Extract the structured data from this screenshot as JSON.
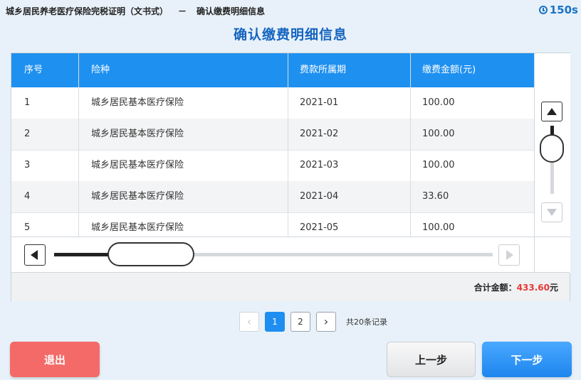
{
  "header": {
    "title": "城乡居民养老医疗保险完税证明（文书式）",
    "separator": "－",
    "step": "确认缴费明细信息",
    "countdown": "150s"
  },
  "page_title": "确认缴费明细信息",
  "table": {
    "columns": [
      "序号",
      "险种",
      "费款所属期",
      "缴费金额(元)"
    ],
    "rows": [
      [
        "1",
        "城乡居民基本医疗保险",
        "2021-01",
        "100.00"
      ],
      [
        "2",
        "城乡居民基本医疗保险",
        "2021-02",
        "100.00"
      ],
      [
        "3",
        "城乡居民基本医疗保险",
        "2021-03",
        "100.00"
      ],
      [
        "4",
        "城乡居民基本医疗保险",
        "2021-04",
        "33.60"
      ],
      [
        "5",
        "城乡居民基本医疗保险",
        "2021-05",
        "100.00"
      ]
    ]
  },
  "summary": {
    "label": "合计金额：",
    "amount": "433.60",
    "unit": "元"
  },
  "pagination": {
    "pages": [
      "1",
      "2"
    ],
    "current": "1",
    "records": "共20条记录"
  },
  "buttons": {
    "exit": "退出",
    "prev": "上一步",
    "next": "下一步"
  },
  "colors": {
    "accent": "#1e90f0",
    "total_amount": "#e53935",
    "exit_button": "#f46a68"
  }
}
